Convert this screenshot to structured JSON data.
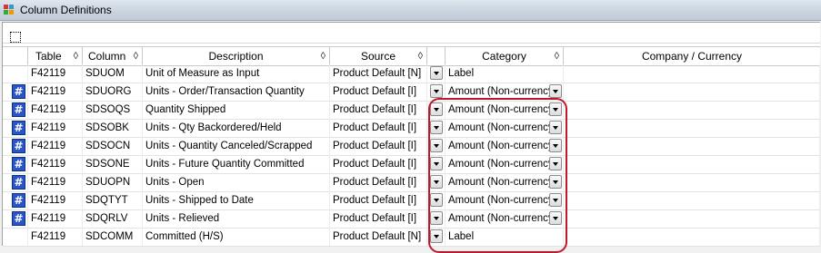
{
  "window": {
    "title": "Column Definitions"
  },
  "columns": {
    "table": "Table",
    "column": "Column",
    "description": "Description",
    "source": "Source",
    "category": "Category",
    "company_currency": "Company / Currency"
  },
  "rows": [
    {
      "table": "F42119",
      "column": "SDUOM",
      "description": "Unit of Measure as Input",
      "source": "Product Default [N]",
      "category": "Label",
      "category_dropdown": false,
      "numeric_icon": false
    },
    {
      "table": "F42119",
      "column": "SDUORG",
      "description": "Units - Order/Transaction Quantity",
      "source": "Product Default [I]",
      "category": "Amount (Non-currency)",
      "category_dropdown": true,
      "numeric_icon": true
    },
    {
      "table": "F42119",
      "column": "SDSOQS",
      "description": "Quantity Shipped",
      "source": "Product Default [I]",
      "category": "Amount (Non-currency)",
      "category_dropdown": true,
      "numeric_icon": true
    },
    {
      "table": "F42119",
      "column": "SDSOBK",
      "description": "Units - Qty Backordered/Held",
      "source": "Product Default [I]",
      "category": "Amount (Non-currency)",
      "category_dropdown": true,
      "numeric_icon": true
    },
    {
      "table": "F42119",
      "column": "SDSOCN",
      "description": "Units - Quantity Canceled/Scrapped",
      "source": "Product Default [I]",
      "category": "Amount (Non-currency)",
      "category_dropdown": true,
      "numeric_icon": true
    },
    {
      "table": "F42119",
      "column": "SDSONE",
      "description": "Units - Future Quantity Committed",
      "source": "Product Default [I]",
      "category": "Amount (Non-currency)",
      "category_dropdown": true,
      "numeric_icon": true
    },
    {
      "table": "F42119",
      "column": "SDUOPN",
      "description": "Units - Open",
      "source": "Product Default [I]",
      "category": "Amount (Non-currency)",
      "category_dropdown": true,
      "numeric_icon": true
    },
    {
      "table": "F42119",
      "column": "SDQTYT",
      "description": "Units - Shipped to Date",
      "source": "Product Default [I]",
      "category": "Amount (Non-currency)",
      "category_dropdown": true,
      "numeric_icon": true
    },
    {
      "table": "F42119",
      "column": "SDQRLV",
      "description": "Units - Relieved",
      "source": "Product Default [I]",
      "category": "Amount (Non-currency)",
      "category_dropdown": true,
      "numeric_icon": true
    },
    {
      "table": "F42119",
      "column": "SDCOMM",
      "description": "Committed (H/S)",
      "source": "Product Default [N]",
      "category": "Label",
      "category_dropdown": false,
      "numeric_icon": false
    }
  ],
  "icons": {
    "app": "column-definitions-app-icon",
    "numeric": "hash-icon",
    "sort": "sort-diamond-icon",
    "dropdown": "chevron-down-icon"
  },
  "colors": {
    "highlight": "#c0182a",
    "numeric_icon": "#2a54c9"
  }
}
